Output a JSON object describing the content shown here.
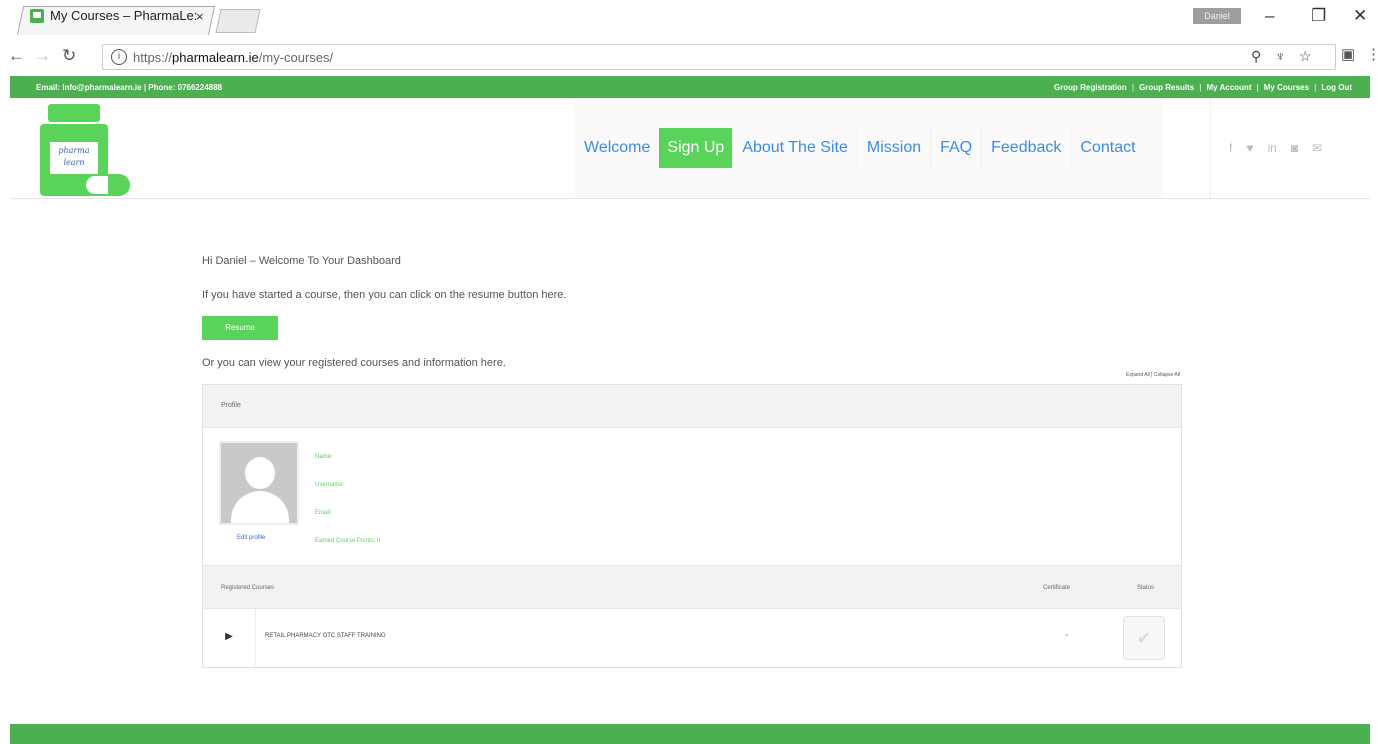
{
  "browser": {
    "tab_title": "My Courses – PharmaLe:",
    "tab_close": "×",
    "url_domain": "pharmalearn.ie",
    "url_prefix": "https://",
    "url_path": "/my-courses/",
    "user_badge": "Daniel"
  },
  "site": {
    "topbar": {
      "contact": "Email: info@pharmalearn.ie | Phone: 0766224888",
      "links": [
        "Group Registration",
        "Group Results",
        "My Account",
        "My Courses",
        "Log Out"
      ]
    },
    "logo_text": "pharma learn",
    "nav": [
      "Welcome",
      "Sign Up",
      "About The Site",
      "Mission",
      "FAQ",
      "Feedback",
      "Contact"
    ],
    "social_icons": [
      "facebook-icon",
      "twitter-icon",
      "linkedin-icon",
      "instagram-icon",
      "email-icon"
    ]
  },
  "dashboard": {
    "greeting": "Hi Daniel – Welcome To Your Dashboard",
    "resume_text": "If you have started a course, then you can click on the resume button here.",
    "resume_button": "Resume",
    "courses_text": "Or you can view your registered courses and information here.",
    "expand_all": "Expand All",
    "collapse_all": "Collapse All",
    "profile": {
      "heading": "Profile",
      "edit_profile": "Edit profile",
      "name_label": "Name:",
      "username_label": "Username:",
      "email_label": "Email:",
      "points_label": "Earned Course Points: 0"
    },
    "courses": {
      "heading": "Registered Courses",
      "certificate_col": "Certificate",
      "status_col": "Status",
      "rows": [
        {
          "name": "RETAIL PHARMACY OTC STAFF TRAINING",
          "certificate": "-"
        }
      ]
    }
  }
}
